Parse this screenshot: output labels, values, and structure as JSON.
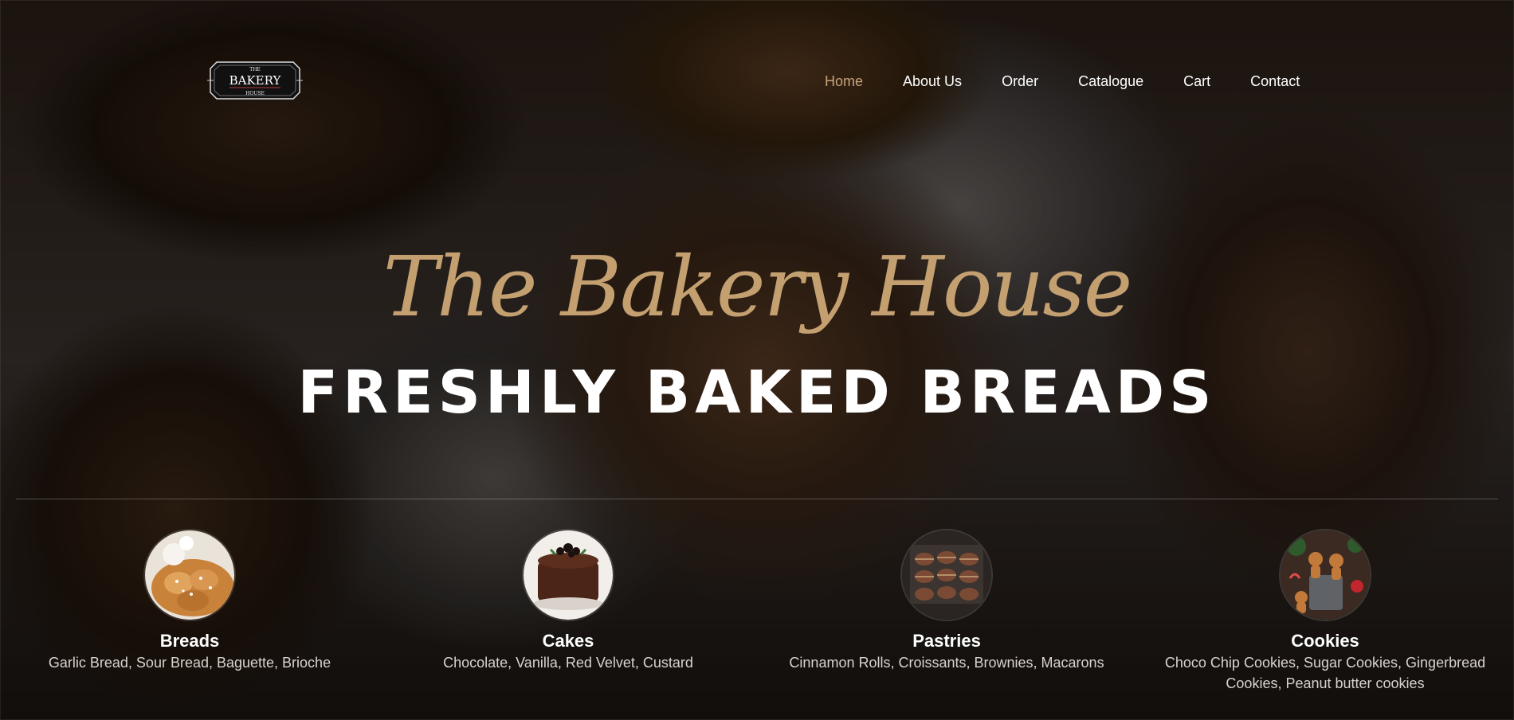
{
  "logo": {
    "line_top": "THE",
    "line_main": "BAKERY",
    "line_bottom": "HOUSE"
  },
  "nav": {
    "items": [
      {
        "label": "Home",
        "active": true
      },
      {
        "label": "About Us",
        "active": false
      },
      {
        "label": "Order",
        "active": false
      },
      {
        "label": "Catalogue",
        "active": false
      },
      {
        "label": "Cart",
        "active": false
      },
      {
        "label": "Contact",
        "active": false
      }
    ]
  },
  "hero": {
    "script_title": "The Bakery House",
    "headline": "FRESHLY BAKED BREADS"
  },
  "categories": [
    {
      "title": "Breads",
      "description": "Garlic Bread, Sour Bread, Baguette, Brioche",
      "image": "braided-brioche-photo"
    },
    {
      "title": "Cakes",
      "description": "Chocolate, Vanilla, Red Velvet, Custard",
      "image": "chocolate-cake-photo"
    },
    {
      "title": "Pastries",
      "description": "Cinnamon Rolls, Croissants, Brownies, Macarons",
      "image": "chocolate-macarons-photo"
    },
    {
      "title": "Cookies",
      "description": "Choco Chip Cookies, Sugar Cookies, Gingerbread Cookies, Peanut butter cookies",
      "image": "gingerbread-cookies-photo"
    }
  ],
  "colors": {
    "accent": "#c4a071",
    "nav_active": "#c9a37a",
    "text": "#ffffff"
  }
}
